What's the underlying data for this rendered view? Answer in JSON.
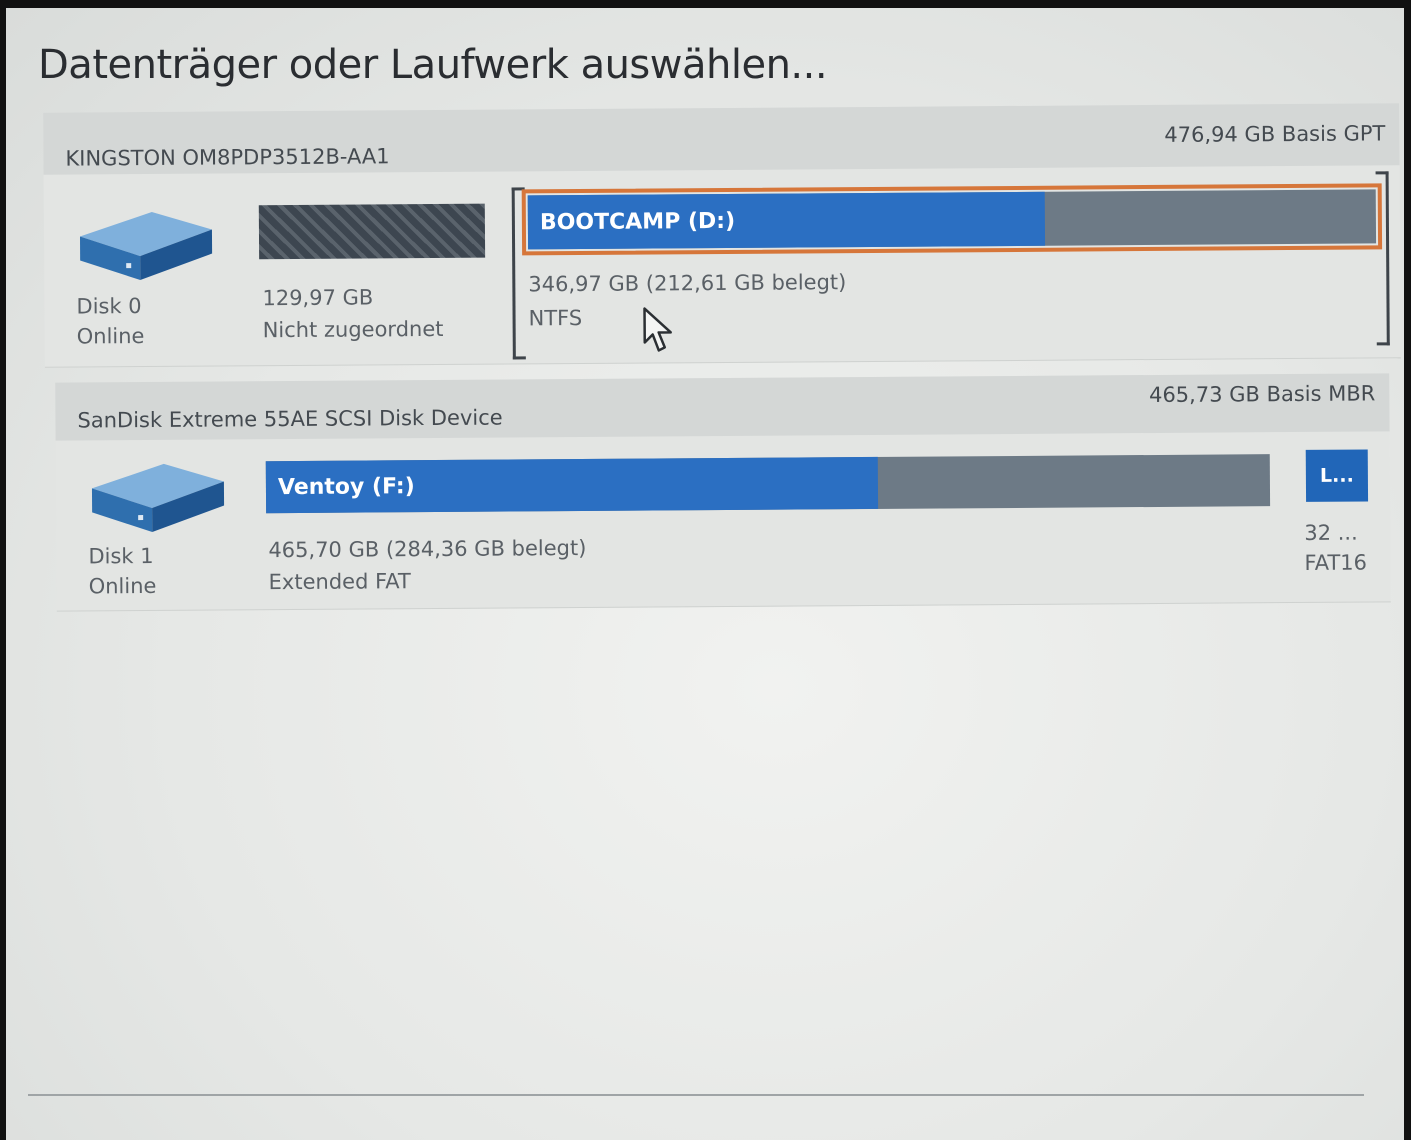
{
  "title": "Datenträger oder Laufwerk auswählen...",
  "disks": [
    {
      "name": "KINGSTON OM8PDP3512B-AA1",
      "summary": "476,94 GB Basis GPT",
      "disk_id": "Disk 0",
      "status": "Online",
      "unallocated": {
        "size": "129,97 GB",
        "label": "Nicht zugeordnet"
      },
      "partition": {
        "label": "BOOTCAMP (D:)",
        "size_info": "346,97 GB (212,61 GB belegt)",
        "filesystem": "NTFS",
        "used_fraction": 0.61,
        "selected": true
      }
    },
    {
      "name": "SanDisk Extreme 55AE SCSI Disk Device",
      "summary": "465,73 GB Basis MBR",
      "disk_id": "Disk 1",
      "status": "Online",
      "partition": {
        "label": "Ventoy (F:)",
        "size_info": "465,70 GB (284,36 GB belegt)",
        "filesystem": "Extended FAT",
        "used_fraction": 0.61
      },
      "small_partition": {
        "label": "L...",
        "size_info": "32 ...",
        "filesystem": "FAT16"
      }
    }
  ],
  "colors": {
    "used": "#2b6fc2",
    "free": "#6d7a86",
    "selection": "#d6763a",
    "header": "#d4d7d6"
  },
  "icons": [
    "hard-drive-icon",
    "mouse-pointer-icon"
  ]
}
